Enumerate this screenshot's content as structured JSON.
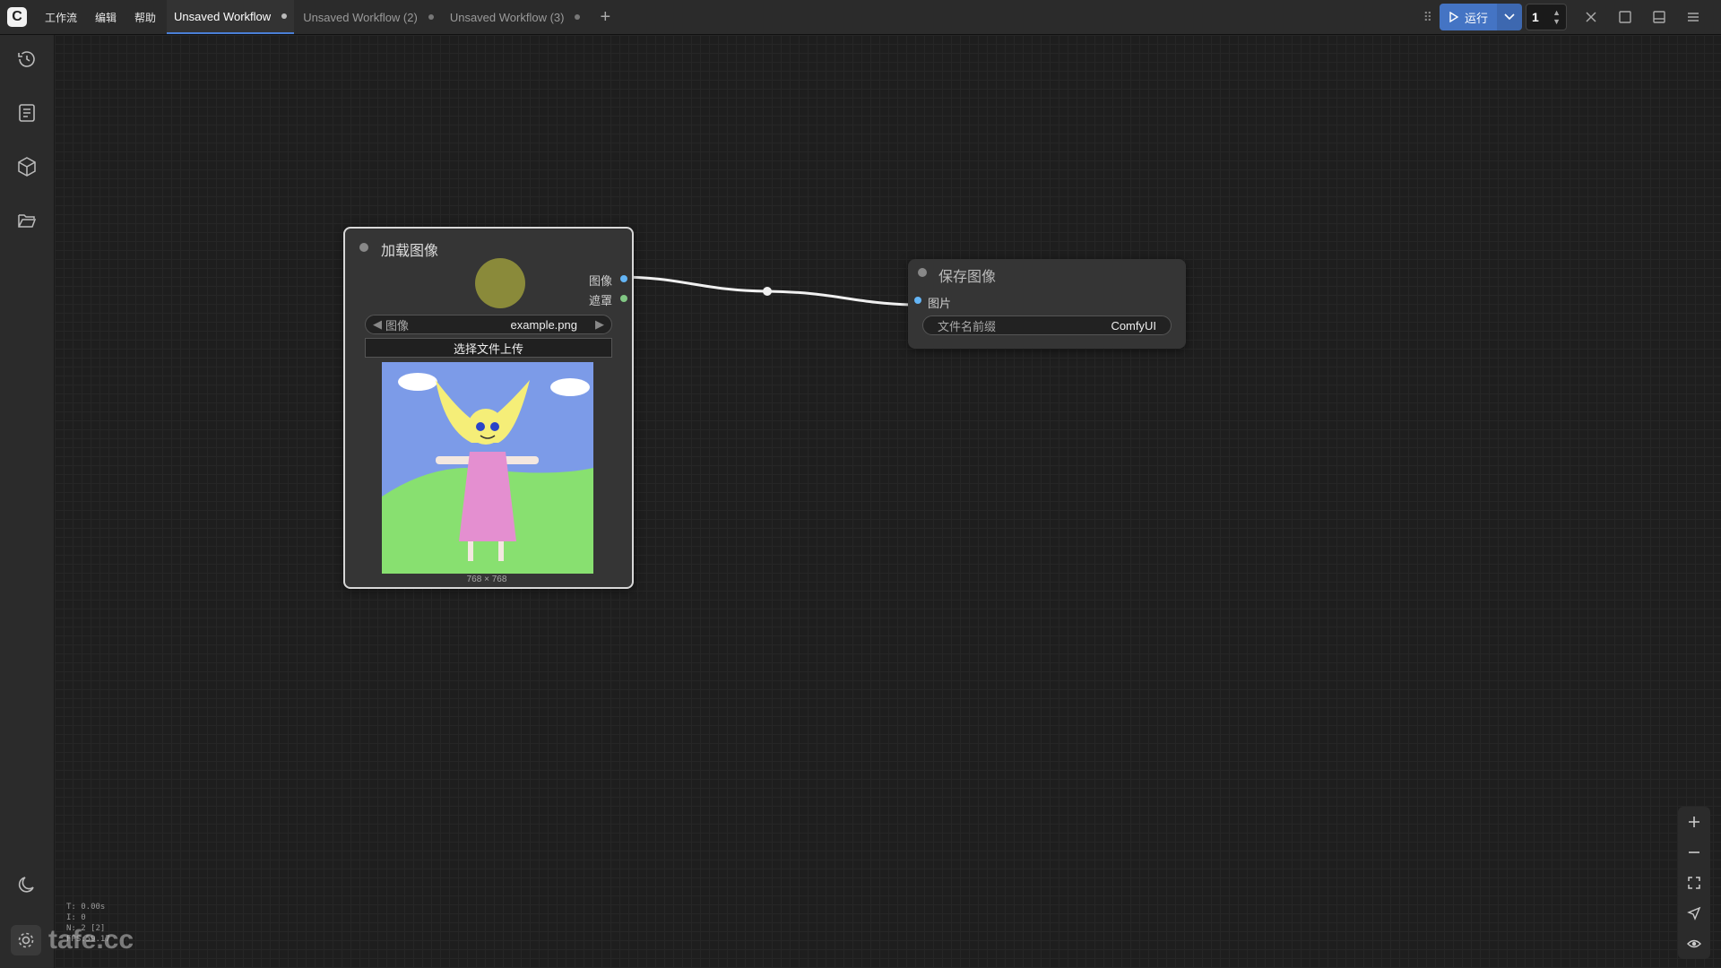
{
  "menu": {
    "logo": "C",
    "items": [
      "工作流",
      "编辑",
      "帮助"
    ]
  },
  "tabs": [
    {
      "label": "Unsaved Workflow",
      "active": true
    },
    {
      "label": "Unsaved Workflow (2)",
      "active": false
    },
    {
      "label": "Unsaved Workflow (3)",
      "active": false
    }
  ],
  "toolbar": {
    "run_label": "运行",
    "batch_count": "1"
  },
  "nodes": {
    "load_image": {
      "title": "加载图像",
      "outputs": [
        "图像",
        "遮罩"
      ],
      "image_widget_label": "图像",
      "image_widget_value": "example.png",
      "upload_label": "选择文件上传",
      "dimensions": "768 × 768"
    },
    "save_image": {
      "title": "保存图像",
      "input": "图片",
      "prefix_label": "文件名前缀",
      "prefix_value": "ComfyUI"
    }
  },
  "stats": {
    "t": "T: 0.00s",
    "i": "I: 0",
    "n": "N: 2 [2]",
    "fps": "FPS:59.17"
  },
  "watermark": "tafe.cc",
  "colors": {
    "accent": "#4474c4",
    "image_slot": "#64b5f6",
    "mask_slot": "#81c784"
  }
}
